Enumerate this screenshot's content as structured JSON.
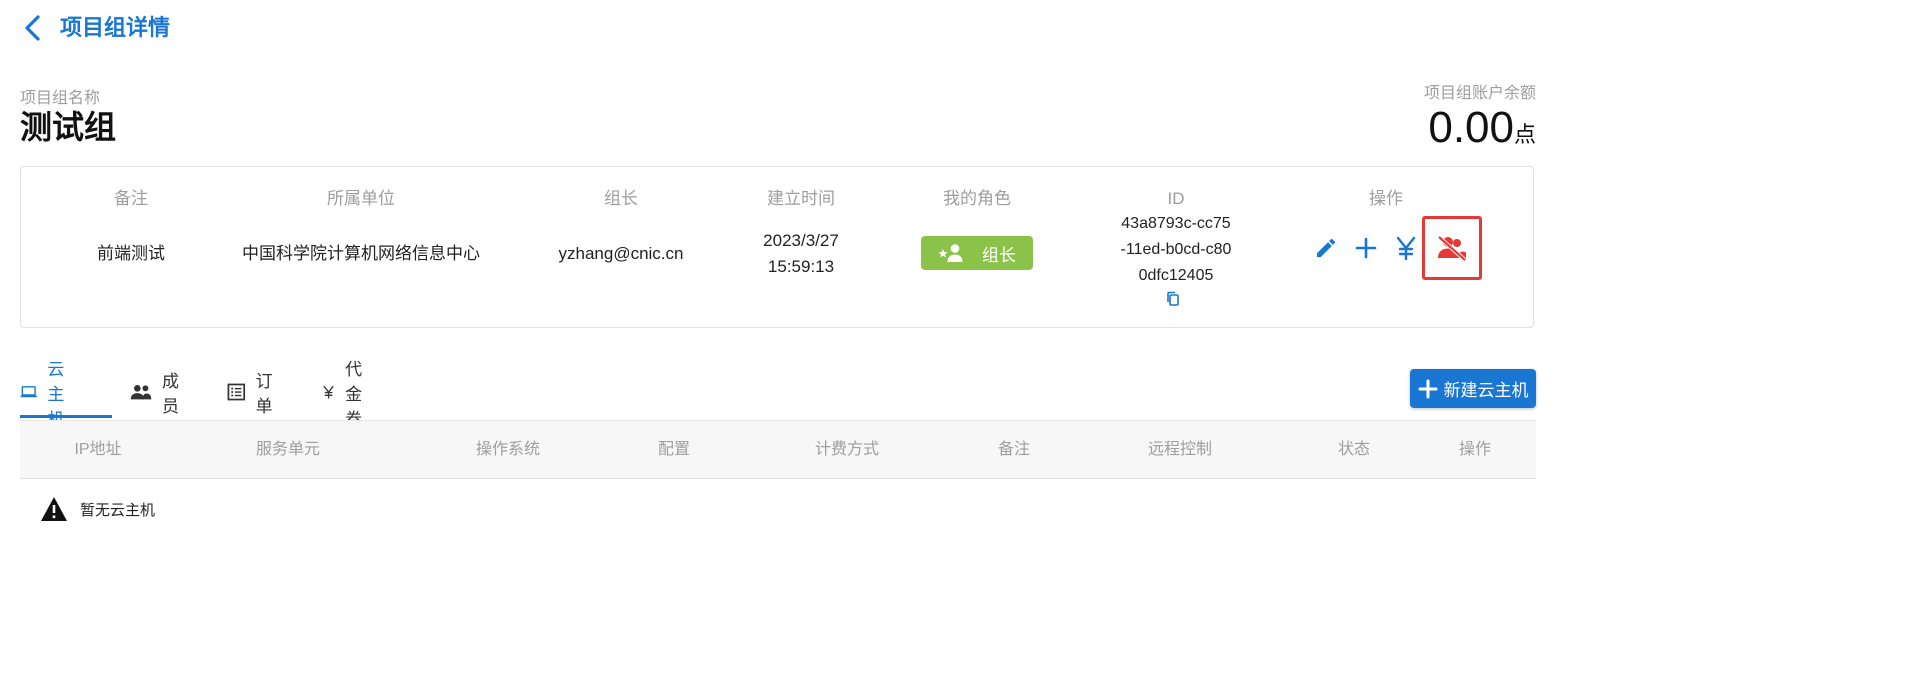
{
  "header": {
    "title": "项目组详情"
  },
  "group": {
    "name_label": "项目组名称",
    "name": "测试组",
    "balance_label": "项目组账户余额",
    "balance_value": "0.00",
    "balance_unit": "点"
  },
  "info": {
    "headers": {
      "remark": "备注",
      "org": "所属单位",
      "leader": "组长",
      "created": "建立时间",
      "role": "我的角色",
      "id": "ID",
      "actions": "操作"
    },
    "values": {
      "remark": "前端测试",
      "org": "中国科学院计算机网络信息中心",
      "leader": "yzhang@cnic.cn",
      "created_date": "2023/3/27",
      "created_time": "15:59:13",
      "role": "组长",
      "id_line1": "43a8793c-cc75",
      "id_line2": "-11ed-b0cd-c80",
      "id_line3": "0dfc12405"
    },
    "action_icons": [
      "edit-icon",
      "add-icon",
      "yuan-icon",
      "remove-member-icon"
    ]
  },
  "tabs": [
    {
      "label": "云主机",
      "icon": "laptop-icon",
      "active": true
    },
    {
      "label": "成员",
      "icon": "people-icon",
      "active": false
    },
    {
      "label": "订单",
      "icon": "list-icon",
      "active": false
    },
    {
      "label": "代金券",
      "icon": "yuan-icon",
      "active": false
    }
  ],
  "new_button": {
    "label": "新建云主机"
  },
  "table": {
    "columns": [
      "IP地址",
      "服务单元",
      "操作系统",
      "配置",
      "计费方式",
      "备注",
      "远程控制",
      "状态",
      "操作"
    ],
    "empty_text": "暂无云主机"
  },
  "colors": {
    "primary": "#1976d2",
    "role_chip": "#8bc34a",
    "danger": "#e53935"
  }
}
